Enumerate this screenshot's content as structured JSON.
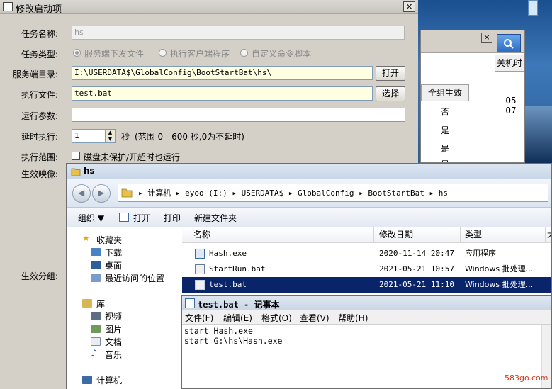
{
  "dialog": {
    "title": "修改启动项",
    "close": "×",
    "labels": {
      "task_name": "任务名称:",
      "task_type": "任务类型:",
      "server_dir": "服务端目录:",
      "exec_file": "执行文件:",
      "run_params": "运行参数:",
      "delay": "延时执行:",
      "scope": "执行范围:",
      "effective_image": "生效映像:",
      "effective_group": "生效分组:"
    },
    "task_name_value": "hs",
    "task_types": [
      "服务端下发文件",
      "执行客户端程序",
      "自定义命令脚本"
    ],
    "server_dir_value": "I:\\USERDATA$\\GlobalConfig\\BootStartBat\\hs\\",
    "open_button": "打开",
    "exec_file_value": "test.bat",
    "choose_button": "选择",
    "run_params_value": "",
    "delay_value": "1",
    "delay_unit": "秒",
    "delay_hint": "(范围 0 - 600 秒,0为不延时)",
    "scope_checkbox": "磁盘未保护/开超时也运行"
  },
  "bg_window": {
    "close": "×",
    "col_all_effect": "全组生效",
    "col_shutdown": "关机时",
    "date_partial": "-05-07",
    "values": [
      "否",
      "是",
      "是",
      "是"
    ]
  },
  "explorer": {
    "title": "hs",
    "address": "▸ 计算机 ▸ eyoo (I:) ▸ USERDATA$ ▸ GlobalConfig ▸ BootStartBat ▸ hs",
    "toolbar": {
      "organize": "组织 ▼",
      "open": "打开",
      "print": "打印",
      "new_folder": "新建文件夹"
    },
    "nav": {
      "favorites": "收藏夹",
      "downloads": "下载",
      "desktop": "桌面",
      "recent": "最近访问的位置",
      "library": "库",
      "videos": "视频",
      "pictures": "图片",
      "documents": "文档",
      "music": "音乐",
      "computer": "计算机"
    },
    "columns": {
      "name": "名称",
      "date": "修改日期",
      "type": "类型",
      "size": "大"
    },
    "files": [
      {
        "name": "Hash.exe",
        "date": "2020-11-14 20:47",
        "type": "应用程序"
      },
      {
        "name": "StartRun.bat",
        "date": "2021-05-21 10:57",
        "type": "Windows 批处理..."
      },
      {
        "name": "test.bat",
        "date": "2021-05-21 11:10",
        "type": "Windows 批处理..."
      }
    ]
  },
  "notepad": {
    "title": "test.bat - 记事本",
    "menu": [
      "文件(F)",
      "编辑(E)",
      "格式(O)",
      "查看(V)",
      "帮助(H)"
    ],
    "content": "start Hash.exe\nstart G:\\hs\\Hash.exe"
  },
  "watermark": "583go.com",
  "colors": {
    "selection": "#0a246a",
    "dialog_bg": "#d4d0c8",
    "input_highlight": "#ffffe1"
  }
}
